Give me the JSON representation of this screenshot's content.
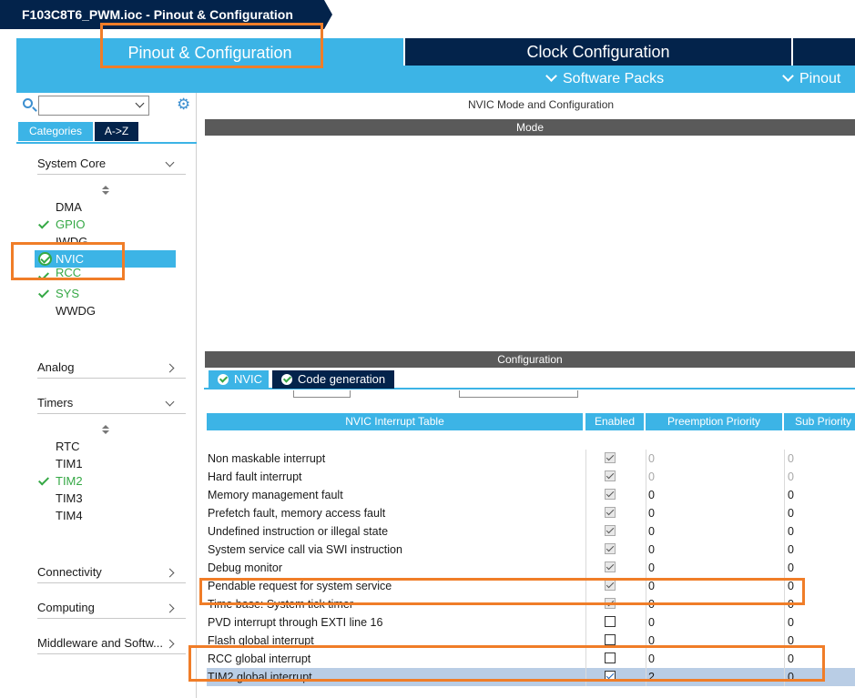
{
  "breadcrumb": {
    "title": "F103C8T6_PWM.ioc - Pinout & Configuration"
  },
  "tabs": {
    "pinout": "Pinout & Configuration",
    "clock": "Clock Configuration",
    "software_packs": "Software Packs",
    "pinout_menu": "Pinout"
  },
  "sidebar": {
    "category_tabs": [
      "Categories",
      "A->Z"
    ],
    "sections": {
      "system_core": "System Core",
      "analog": "Analog",
      "timers": "Timers",
      "connectivity": "Connectivity",
      "computing": "Computing",
      "middleware": "Middleware and Softw..."
    },
    "system_core_items": [
      "DMA",
      "GPIO",
      "IWDG",
      "NVIC",
      "RCC",
      "SYS",
      "WWDG"
    ],
    "timers_items": [
      "RTC",
      "TIM1",
      "TIM2",
      "TIM3",
      "TIM4"
    ]
  },
  "main": {
    "title": "NVIC Mode and Configuration",
    "mode_header": "Mode",
    "config_header": "Configuration",
    "config_tabs": [
      "NVIC",
      "Code generation"
    ],
    "table": {
      "headers": [
        "NVIC Interrupt Table",
        "Enabled",
        "Preemption Priority",
        "Sub Priority"
      ],
      "rows": [
        {
          "name": "Non maskable interrupt",
          "enabled": true,
          "locked": true,
          "preemption": "0",
          "sub": "0"
        },
        {
          "name": "Hard fault interrupt",
          "enabled": true,
          "locked": true,
          "preemption": "0",
          "sub": "0"
        },
        {
          "name": "Memory management fault",
          "enabled": true,
          "locked": true,
          "preemption": "0",
          "sub": "0"
        },
        {
          "name": "Prefetch fault, memory access fault",
          "enabled": true,
          "locked": true,
          "preemption": "0",
          "sub": "0"
        },
        {
          "name": "Undefined instruction or illegal state",
          "enabled": true,
          "locked": true,
          "preemption": "0",
          "sub": "0"
        },
        {
          "name": "System service call via SWI instruction",
          "enabled": true,
          "locked": true,
          "preemption": "0",
          "sub": "0"
        },
        {
          "name": "Debug monitor",
          "enabled": true,
          "locked": true,
          "preemption": "0",
          "sub": "0"
        },
        {
          "name": "Pendable request for system service",
          "enabled": true,
          "locked": true,
          "preemption": "0",
          "sub": "0"
        },
        {
          "name": "Time base: System tick timer",
          "enabled": true,
          "locked": true,
          "preemption": "0",
          "sub": "0"
        },
        {
          "name": "PVD interrupt through EXTI line 16",
          "enabled": false,
          "locked": false,
          "preemption": "0",
          "sub": "0"
        },
        {
          "name": "Flash global interrupt",
          "enabled": false,
          "locked": false,
          "preemption": "0",
          "sub": "0"
        },
        {
          "name": "RCC global interrupt",
          "enabled": false,
          "locked": false,
          "preemption": "0",
          "sub": "0"
        },
        {
          "name": "TIM2 global interrupt",
          "enabled": true,
          "locked": false,
          "preemption": "2",
          "sub": "0"
        }
      ]
    }
  },
  "colors": {
    "accent": "#3cb4e6",
    "dark": "#03234b",
    "highlight": "#f07d28",
    "enabled_green": "#35a845"
  }
}
